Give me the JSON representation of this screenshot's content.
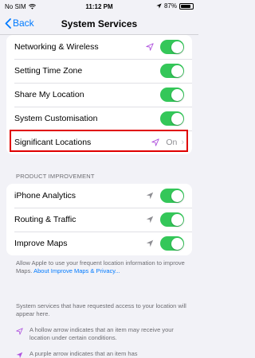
{
  "status_bar": {
    "carrier": "No SIM",
    "time": "11:12 PM",
    "battery_percent": "87%",
    "battery_level": 0.87
  },
  "nav": {
    "back_label": "Back",
    "title": "System Services"
  },
  "top_group": [
    {
      "label": "Networking & Wireless",
      "arrow": "hollow-purple-arrow-icon",
      "toggle": true
    },
    {
      "label": "Setting Time Zone",
      "toggle": true
    },
    {
      "label": "Share My Location",
      "toggle": true
    },
    {
      "label": "System Customisation",
      "toggle": true
    },
    {
      "label": "Significant Locations",
      "arrow": "hollow-purple-arrow-icon",
      "value": "On"
    }
  ],
  "product_improvement": {
    "header": "PRODUCT IMPROVEMENT",
    "rows": [
      {
        "label": "iPhone Analytics",
        "arrow": "gray-arrow-icon",
        "toggle": true
      },
      {
        "label": "Routing & Traffic",
        "arrow": "gray-arrow-icon",
        "toggle": true
      },
      {
        "label": "Improve Maps",
        "arrow": "gray-arrow-icon",
        "toggle": true
      }
    ],
    "footer": "Allow Apple to use your frequent location information to improve Maps. ",
    "footer_link": "About Improve Maps & Privacy..."
  },
  "legend": {
    "intro": "System services that have requested access to your location will appear here.",
    "hollow": "A hollow arrow indicates that an item may receive your location under certain conditions.",
    "purple": "A purple arrow indicates that an item has"
  },
  "colors": {
    "accent": "#007aff",
    "toggle_on": "#34c759",
    "highlight": "#e00000",
    "purple_arrow": "#af52de"
  }
}
